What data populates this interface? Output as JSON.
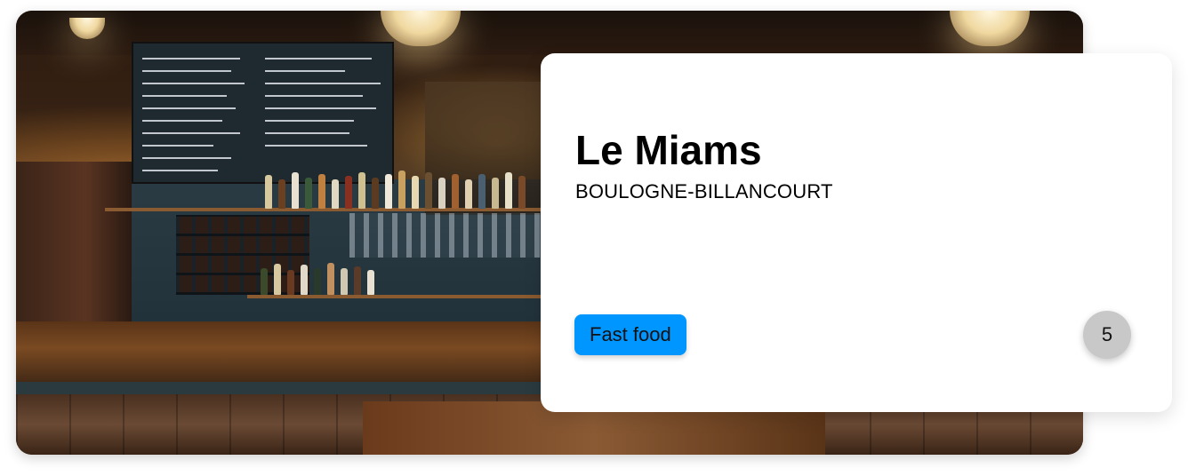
{
  "restaurant": {
    "name": "Le Miams",
    "city": "BOULOGNE-BILLANCOURT",
    "category": "Fast food",
    "rating": "5"
  },
  "colors": {
    "category_badge": "#0096ff",
    "rating_badge": "#c8c8c8",
    "card_background": "#ffffff"
  }
}
